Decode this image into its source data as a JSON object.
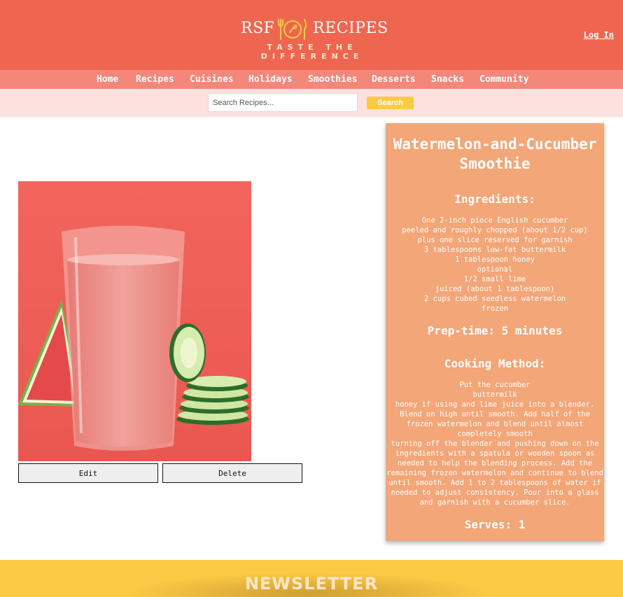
{
  "header": {
    "brand_left": "RSF",
    "brand_right": "RECIPES",
    "tagline": "TASTE THE DIFFERENCE",
    "login_label": "Log In",
    "icon": "fork-knife-plate-icon"
  },
  "nav": {
    "items": [
      "Home",
      "Recipes",
      "Cuisines",
      "Holidays",
      "Smoothies",
      "Desserts",
      "Snacks",
      "Community"
    ]
  },
  "search": {
    "placeholder": "Search Recipes...",
    "button_label": "Search"
  },
  "recipe": {
    "image_alt": "Watermelon and cucumber smoothie in a glass with cucumber slices",
    "edit_label": "Edit",
    "delete_label": "Delete",
    "title": "Watermelon-and-Cucumber Smoothie",
    "ingredients_heading": "Ingredients:",
    "ingredients": [
      "One 2-inch piece English cucumber",
      "peeled and roughly chopped (about 1/2 cup)",
      "plus one slice reserved for garnish",
      "3 tablespoons low-fat buttermilk",
      "1 tablespoon honey",
      "optional",
      "1/2 small lime",
      "juiced (about 1 tablespoon)",
      "2 cups cubed seedless watermelon",
      "frozen"
    ],
    "prep_time": "Prep-time: 5 minutes",
    "method_heading": "Cooking Method:",
    "method": [
      "Put the cucumber",
      "buttermilk",
      "honey if using and lime juice into a blender. Blend on high until smooth. Add half of the frozen watermelon and blend until almost completely smooth",
      "turning off the blender and pushing down on the ingredients with a spatula or wooden spoon as needed to help the blending process. Add the remaining frozen watermelon and continue to blend until smooth. Add 1 to 2 tablespoons of water if needed to adjust consistency. Pour into a glass and garnish with a cucumber slice."
    ],
    "serves": "Serves: 1"
  },
  "newsletter": {
    "title": "NEWSLETTER"
  },
  "colors": {
    "header": "#ef6650",
    "nav": "#f3877a",
    "search_bar": "#fde1de",
    "search_button": "#fccb43",
    "card": "#f3a678",
    "newsletter": "#fcc944"
  }
}
